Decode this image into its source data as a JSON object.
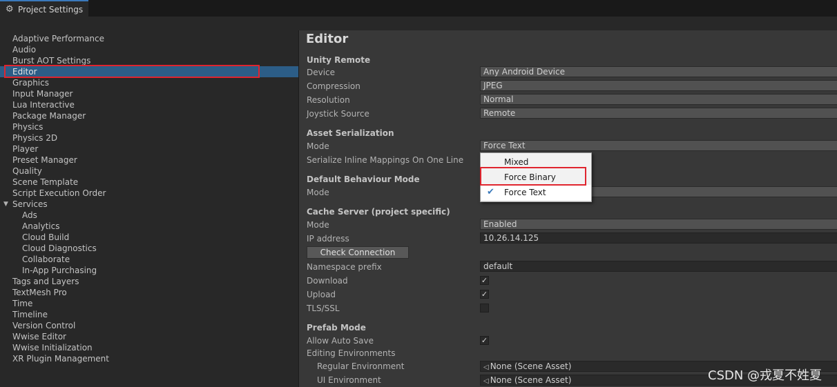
{
  "window": {
    "tab_title": "Project Settings",
    "tab_icon": "gear-icon"
  },
  "sidebar": {
    "items": [
      {
        "label": "Adaptive Performance",
        "indent": 0
      },
      {
        "label": "Audio",
        "indent": 0
      },
      {
        "label": "Burst AOT Settings",
        "indent": 0
      },
      {
        "label": "Editor",
        "indent": 0,
        "selected": true
      },
      {
        "label": "Graphics",
        "indent": 0
      },
      {
        "label": "Input Manager",
        "indent": 0
      },
      {
        "label": "Lua Interactive",
        "indent": 0
      },
      {
        "label": "Package Manager",
        "indent": 0
      },
      {
        "label": "Physics",
        "indent": 0
      },
      {
        "label": "Physics 2D",
        "indent": 0
      },
      {
        "label": "Player",
        "indent": 0
      },
      {
        "label": "Preset Manager",
        "indent": 0
      },
      {
        "label": "Quality",
        "indent": 0
      },
      {
        "label": "Scene Template",
        "indent": 0
      },
      {
        "label": "Script Execution Order",
        "indent": 0
      },
      {
        "label": "Services",
        "indent": 0,
        "expandable": true
      },
      {
        "label": "Ads",
        "indent": 1
      },
      {
        "label": "Analytics",
        "indent": 1
      },
      {
        "label": "Cloud Build",
        "indent": 1
      },
      {
        "label": "Cloud Diagnostics",
        "indent": 1
      },
      {
        "label": "Collaborate",
        "indent": 1
      },
      {
        "label": "In-App Purchasing",
        "indent": 1
      },
      {
        "label": "Tags and Layers",
        "indent": 0
      },
      {
        "label": "TextMesh Pro",
        "indent": 0
      },
      {
        "label": "Time",
        "indent": 0
      },
      {
        "label": "Timeline",
        "indent": 0
      },
      {
        "label": "Version Control",
        "indent": 0
      },
      {
        "label": "Wwise Editor",
        "indent": 0
      },
      {
        "label": "Wwise Initialization",
        "indent": 0
      },
      {
        "label": "XR Plugin Management",
        "indent": 0
      }
    ]
  },
  "panel": {
    "title": "Editor",
    "unity_remote": {
      "heading": "Unity Remote",
      "device_label": "Device",
      "device_value": "Any Android Device",
      "compression_label": "Compression",
      "compression_value": "JPEG",
      "resolution_label": "Resolution",
      "resolution_value": "Normal",
      "joystick_label": "Joystick Source",
      "joystick_value": "Remote"
    },
    "asset_serialization": {
      "heading": "Asset Serialization",
      "mode_label": "Mode",
      "mode_value": "Force Text",
      "inline_label": "Serialize Inline Mappings On One Line"
    },
    "default_behaviour": {
      "heading": "Default Behaviour Mode",
      "mode_label": "Mode"
    },
    "cache_server": {
      "heading": "Cache Server (project specific)",
      "mode_label": "Mode",
      "mode_value": "Enabled",
      "ip_label": "IP address",
      "ip_value": "10.26.14.125",
      "check_button": "Check Connection",
      "namespace_label": "Namespace prefix",
      "namespace_value": "default",
      "download_label": "Download",
      "download_checked": true,
      "upload_label": "Upload",
      "upload_checked": true,
      "tls_label": "TLS/SSL",
      "tls_checked": false
    },
    "prefab_mode": {
      "heading": "Prefab Mode",
      "autosave_label": "Allow Auto Save",
      "autosave_checked": true,
      "editing_env_label": "Editing Environments",
      "regular_env_label": "Regular Environment",
      "regular_env_value": "None (Scene Asset)",
      "ui_env_label": "UI Environment",
      "ui_env_value": "None (Scene Asset)"
    }
  },
  "dropdown": {
    "options": [
      {
        "label": "Mixed",
        "checked": false
      },
      {
        "label": "Force Binary",
        "checked": false
      },
      {
        "label": "Force Text",
        "checked": true
      }
    ]
  },
  "watermark": "CSDN @戎夏不姓夏",
  "colors": {
    "selection": "#2c5d87",
    "highlight": "#e0242e",
    "panel": "#383838",
    "sidebar": "#282828"
  }
}
